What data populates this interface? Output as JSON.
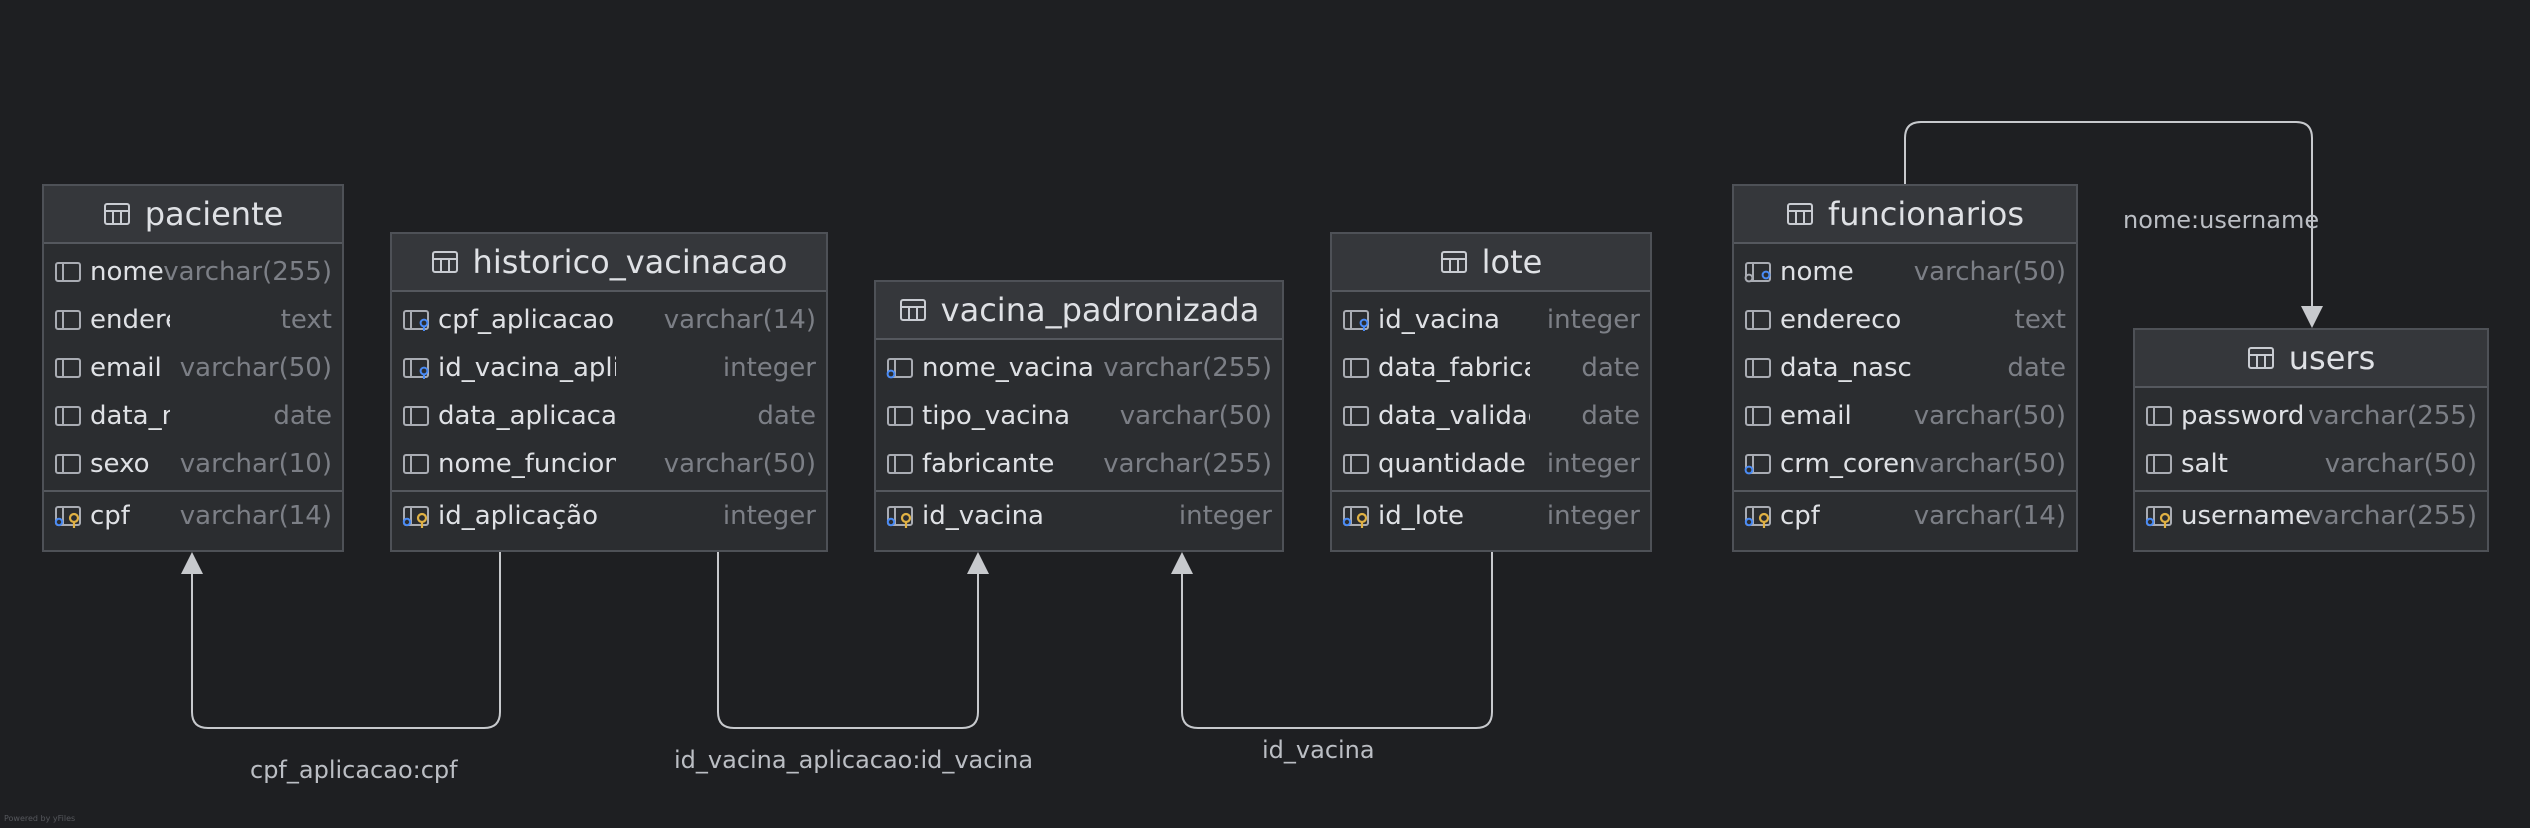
{
  "tables": [
    {
      "name": "paciente",
      "columns": [
        {
          "name": "nome",
          "type": "varchar(255)",
          "icon": "column-icon"
        },
        {
          "name": "endereco",
          "type": "text",
          "icon": "column-icon"
        },
        {
          "name": "email",
          "type": "varchar(50)",
          "icon": "column-icon"
        },
        {
          "name": "data_nasc",
          "type": "date",
          "icon": "column-icon"
        },
        {
          "name": "sexo",
          "type": "varchar(10)",
          "icon": "column-icon"
        }
      ],
      "keys": [
        {
          "name": "cpf",
          "type": "varchar(14)",
          "icon": "primary-key-icon"
        }
      ]
    },
    {
      "name": "historico_vacinacao",
      "columns": [
        {
          "name": "cpf_aplicacao",
          "type": "varchar(14)",
          "icon": "foreign-key-column-icon"
        },
        {
          "name": "id_vacina_aplicacao",
          "type": "integer",
          "icon": "foreign-key-column-icon"
        },
        {
          "name": "data_aplicacao",
          "type": "date",
          "icon": "column-icon"
        },
        {
          "name": "nome_funcionario",
          "type": "varchar(50)",
          "icon": "column-icon"
        }
      ],
      "keys": [
        {
          "name": "id_aplicação",
          "type": "integer",
          "icon": "primary-key-icon"
        }
      ]
    },
    {
      "name": "vacina_padronizada",
      "columns": [
        {
          "name": "nome_vacina",
          "type": "varchar(255)",
          "icon": "unique-key-icon"
        },
        {
          "name": "tipo_vacina",
          "type": "varchar(50)",
          "icon": "column-icon"
        },
        {
          "name": "fabricante",
          "type": "varchar(255)",
          "icon": "column-icon"
        }
      ],
      "keys": [
        {
          "name": "id_vacina",
          "type": "integer",
          "icon": "primary-key-icon"
        }
      ]
    },
    {
      "name": "lote",
      "columns": [
        {
          "name": "id_vacina",
          "type": "integer",
          "icon": "foreign-key-column-icon"
        },
        {
          "name": "data_fabricacao",
          "type": "date",
          "icon": "column-icon"
        },
        {
          "name": "data_validade",
          "type": "date",
          "icon": "column-icon"
        },
        {
          "name": "quantidade",
          "type": "integer",
          "icon": "column-icon"
        }
      ],
      "keys": [
        {
          "name": "id_lote",
          "type": "integer",
          "icon": "primary-key-icon"
        }
      ]
    },
    {
      "name": "funcionarios",
      "columns": [
        {
          "name": "nome",
          "type": "varchar(50)",
          "icon": "unique-foreign-key-icon"
        },
        {
          "name": "endereco",
          "type": "text",
          "icon": "column-icon"
        },
        {
          "name": "data_nasc",
          "type": "date",
          "icon": "column-icon"
        },
        {
          "name": "email",
          "type": "varchar(50)",
          "icon": "column-icon"
        },
        {
          "name": "crm_coren",
          "type": "varchar(50)",
          "icon": "unique-key-icon"
        }
      ],
      "keys": [
        {
          "name": "cpf",
          "type": "varchar(14)",
          "icon": "primary-key-icon"
        }
      ]
    },
    {
      "name": "users",
      "columns": [
        {
          "name": "password",
          "type": "varchar(255)",
          "icon": "column-icon"
        },
        {
          "name": "salt",
          "type": "varchar(50)",
          "icon": "column-icon"
        }
      ],
      "keys": [
        {
          "name": "username",
          "type": "varchar(255)",
          "icon": "primary-key-icon"
        }
      ]
    }
  ],
  "relations": [
    {
      "from": "historico_vacinacao",
      "to": "paciente",
      "label": "cpf_aplicacao:cpf"
    },
    {
      "from": "historico_vacinacao",
      "to": "vacina_padronizada",
      "label": "id_vacina_aplicacao:id_vacina"
    },
    {
      "from": "lote",
      "to": "vacina_padronizada",
      "label": "id_vacina"
    },
    {
      "from": "funcionarios",
      "to": "users",
      "label": "nome:username"
    }
  ],
  "footer": "Powered by yFiles",
  "colors": {
    "background": "#1e1f22",
    "table_body": "#2b2d30",
    "table_header": "#35373b",
    "text": "#dfe1e5",
    "type_text": "#7c7f86",
    "edge": "#c7c9cd",
    "key_gold": "#e0b144",
    "key_blue": "#4a8bf5"
  }
}
